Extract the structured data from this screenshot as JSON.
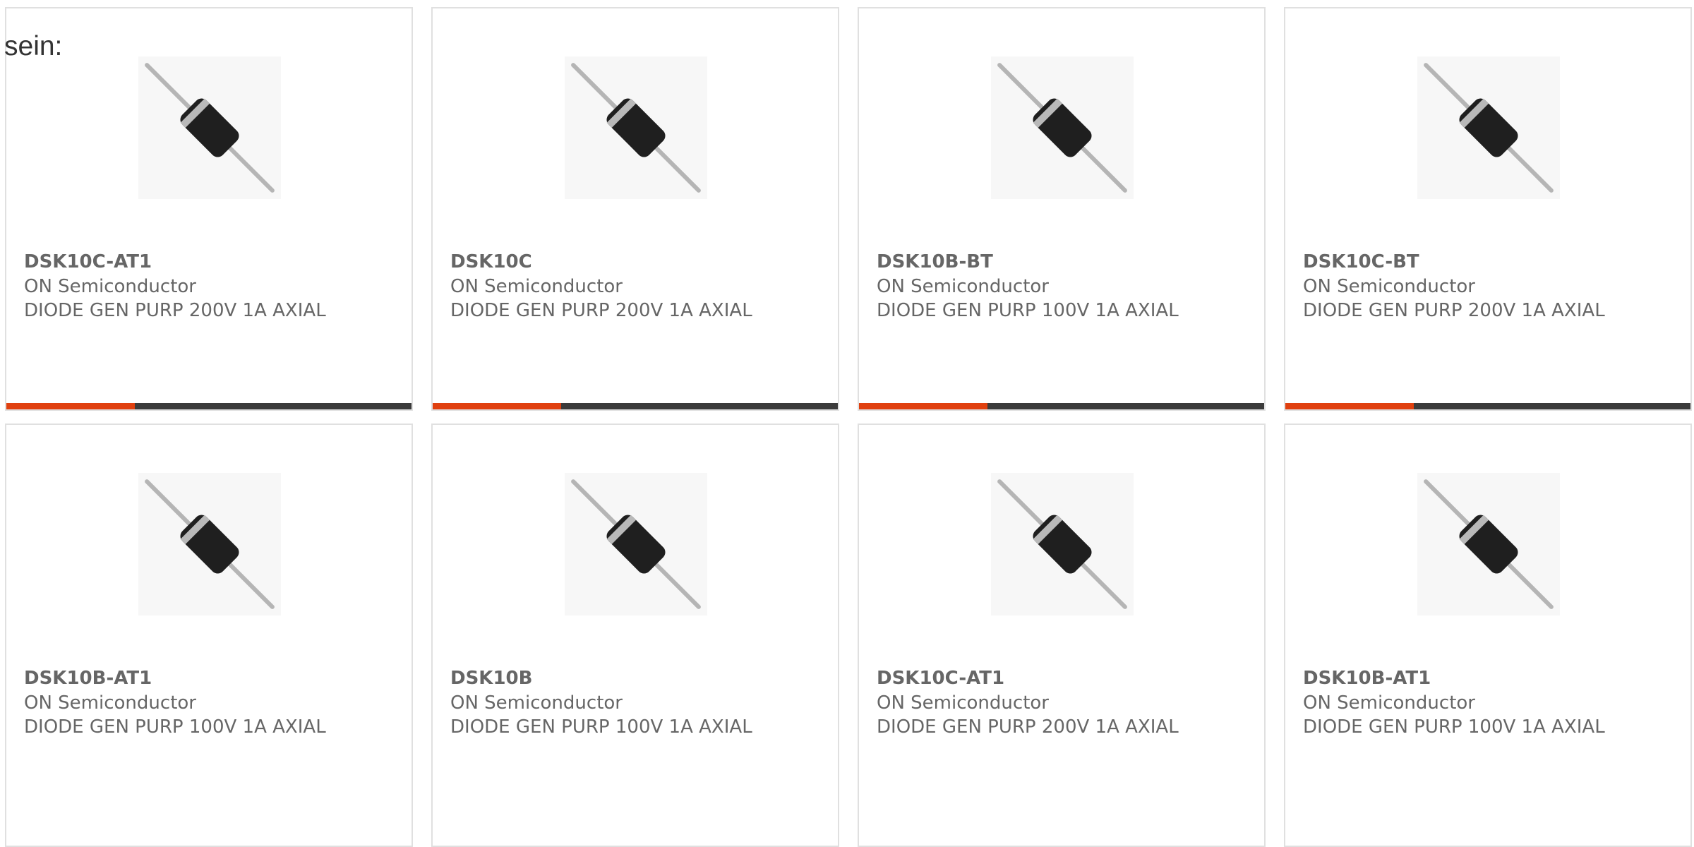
{
  "intro": {
    "text": "sein:"
  },
  "theme": {
    "accent": "#e0400f",
    "bar": "#3b3b3b",
    "title_text": "#666666",
    "border": "#e0e0e0"
  },
  "products": [
    {
      "part": "DSK10C-AT1",
      "manufacturer": "ON Semiconductor",
      "description": "DIODE GEN PURP 200V 1A AXIAL",
      "image_icon": "axial-diode-icon"
    },
    {
      "part": "DSK10C",
      "manufacturer": "ON Semiconductor",
      "description": "DIODE GEN PURP 200V 1A AXIAL",
      "image_icon": "axial-diode-icon"
    },
    {
      "part": "DSK10B-BT",
      "manufacturer": "ON Semiconductor",
      "description": "DIODE GEN PURP 100V 1A AXIAL",
      "image_icon": "axial-diode-icon"
    },
    {
      "part": "DSK10C-BT",
      "manufacturer": "ON Semiconductor",
      "description": "DIODE GEN PURP 200V 1A AXIAL",
      "image_icon": "axial-diode-icon"
    },
    {
      "part": "DSK10B-AT1",
      "manufacturer": "ON Semiconductor",
      "description": "DIODE GEN PURP 100V 1A AXIAL",
      "image_icon": "axial-diode-icon"
    },
    {
      "part": "DSK10B",
      "manufacturer": "ON Semiconductor",
      "description": "DIODE GEN PURP 100V 1A AXIAL",
      "image_icon": "axial-diode-icon"
    },
    {
      "part": "DSK10C-AT1",
      "manufacturer": "ON Semiconductor",
      "description": "DIODE GEN PURP 200V 1A AXIAL",
      "image_icon": "axial-diode-icon"
    },
    {
      "part": "DSK10B-AT1",
      "manufacturer": "ON Semiconductor",
      "description": "DIODE GEN PURP 100V 1A AXIAL",
      "image_icon": "axial-diode-icon"
    }
  ]
}
